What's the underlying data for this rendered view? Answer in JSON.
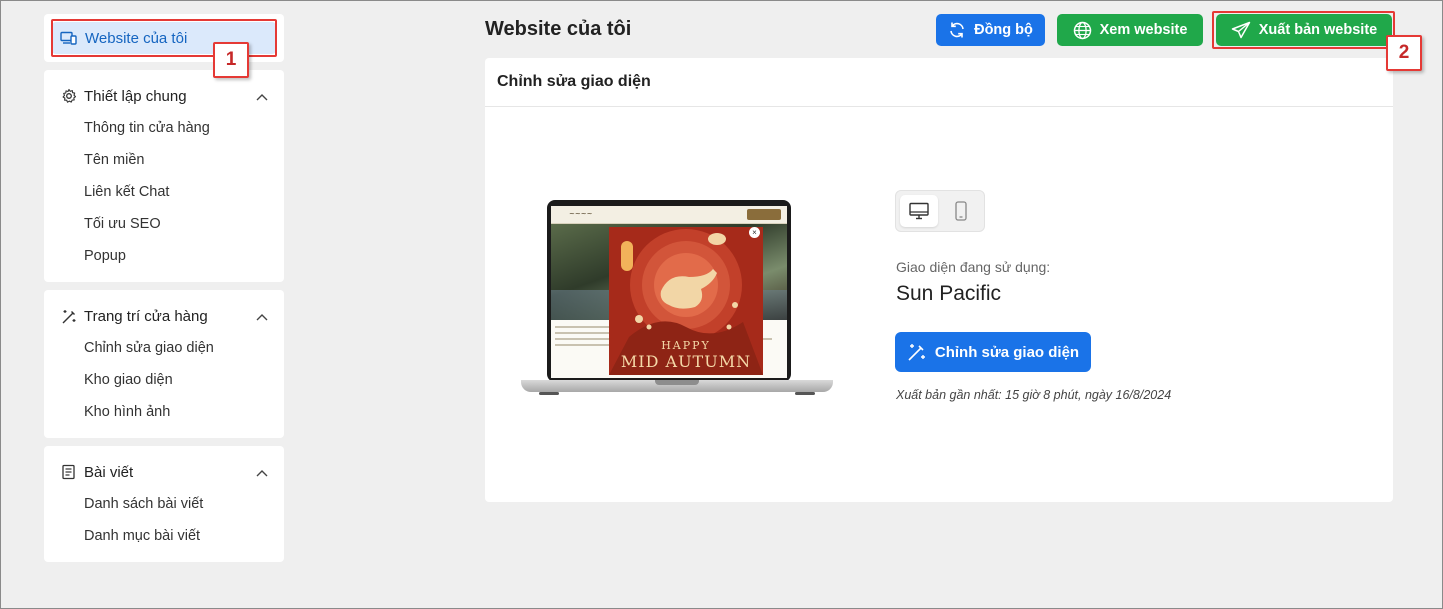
{
  "sidebar": {
    "top_item": {
      "label": "Website của tôi",
      "icon": "devices-icon"
    },
    "sections": [
      {
        "title": "Thiết lập chung",
        "icon": "gear-icon",
        "items": [
          "Thông tin cửa hàng",
          "Tên miền",
          "Liên kết Chat",
          "Tối ưu SEO",
          "Popup"
        ]
      },
      {
        "title": "Trang trí cửa hàng",
        "icon": "magic-wand-icon",
        "items": [
          "Chỉnh sửa giao diện",
          "Kho giao diện",
          "Kho hình ảnh"
        ]
      },
      {
        "title": "Bài viết",
        "icon": "newspaper-icon",
        "items": [
          "Danh sách bài viết",
          "Danh mục bài viết"
        ]
      }
    ]
  },
  "header": {
    "title": "Website của tôi",
    "buttons": {
      "sync": "Đồng bộ",
      "view": "Xem website",
      "publish": "Xuất bản website"
    }
  },
  "panel": {
    "title": "Chỉnh sửa giao diện",
    "preview": {
      "popup_line1": "HAPPY",
      "popup_line2": "MID AUTUMN"
    },
    "theme_label": "Giao diện đang sử dụng:",
    "theme_name": "Sun Pacific",
    "edit_button": "Chỉnh sửa giao diện",
    "last_publish": "Xuất bản gần nhất: 15 giờ 8 phút, ngày 16/8/2024"
  },
  "annotations": {
    "badge1": "1",
    "badge2": "2",
    "color": "#e53935"
  },
  "colors": {
    "primary": "#1a73e8",
    "success": "#20a84a",
    "active_bg": "#dbe9fb"
  }
}
